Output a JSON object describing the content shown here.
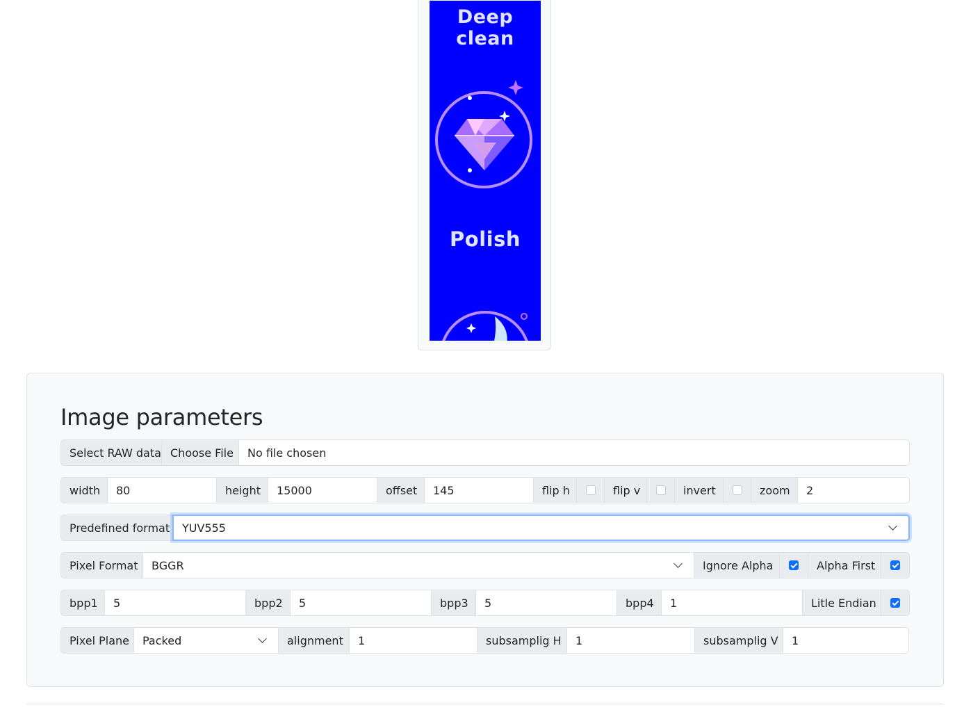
{
  "preview": {
    "text_top": "Deep clean",
    "text_mid": "Polish",
    "bg_color": "#0000ff"
  },
  "panel": {
    "title": "Image parameters",
    "file": {
      "label": "Select RAW data",
      "button": "Choose File",
      "status": "No file chosen"
    },
    "dims": {
      "width_label": "width",
      "width_value": "80",
      "height_label": "height",
      "height_value": "15000",
      "offset_label": "offset",
      "offset_value": "145",
      "fliph_label": "flip h",
      "fliph_checked": false,
      "flipv_label": "flip v",
      "flipv_checked": false,
      "invert_label": "invert",
      "invert_checked": false,
      "zoom_label": "zoom",
      "zoom_value": "2"
    },
    "predefined": {
      "label": "Predefined format",
      "value": "YUV555"
    },
    "pixel_format": {
      "label": "Pixel Format",
      "value": "BGGR",
      "ignore_alpha_label": "Ignore Alpha",
      "ignore_alpha_checked": true,
      "alpha_first_label": "Alpha First",
      "alpha_first_checked": true
    },
    "bpp": {
      "bpp1_label": "bpp1",
      "bpp1_value": "5",
      "bpp2_label": "bpp2",
      "bpp2_value": "5",
      "bpp3_label": "bpp3",
      "bpp3_value": "5",
      "bpp4_label": "bpp4",
      "bpp4_value": "1",
      "endian_label": "Litle Endian",
      "endian_checked": true
    },
    "plane": {
      "label": "Pixel Plane",
      "value": "Packed",
      "alignment_label": "alignment",
      "alignment_value": "1",
      "subh_label": "subsamplig H",
      "subh_value": "1",
      "subv_label": "subsamplig V",
      "subv_value": "1"
    }
  },
  "colors": {
    "accent": "#0d6efd",
    "focus_ring": "#86b7fe",
    "panel_bg": "#f8f9fa",
    "label_bg": "#e9ecef",
    "border": "#dee2e6"
  }
}
